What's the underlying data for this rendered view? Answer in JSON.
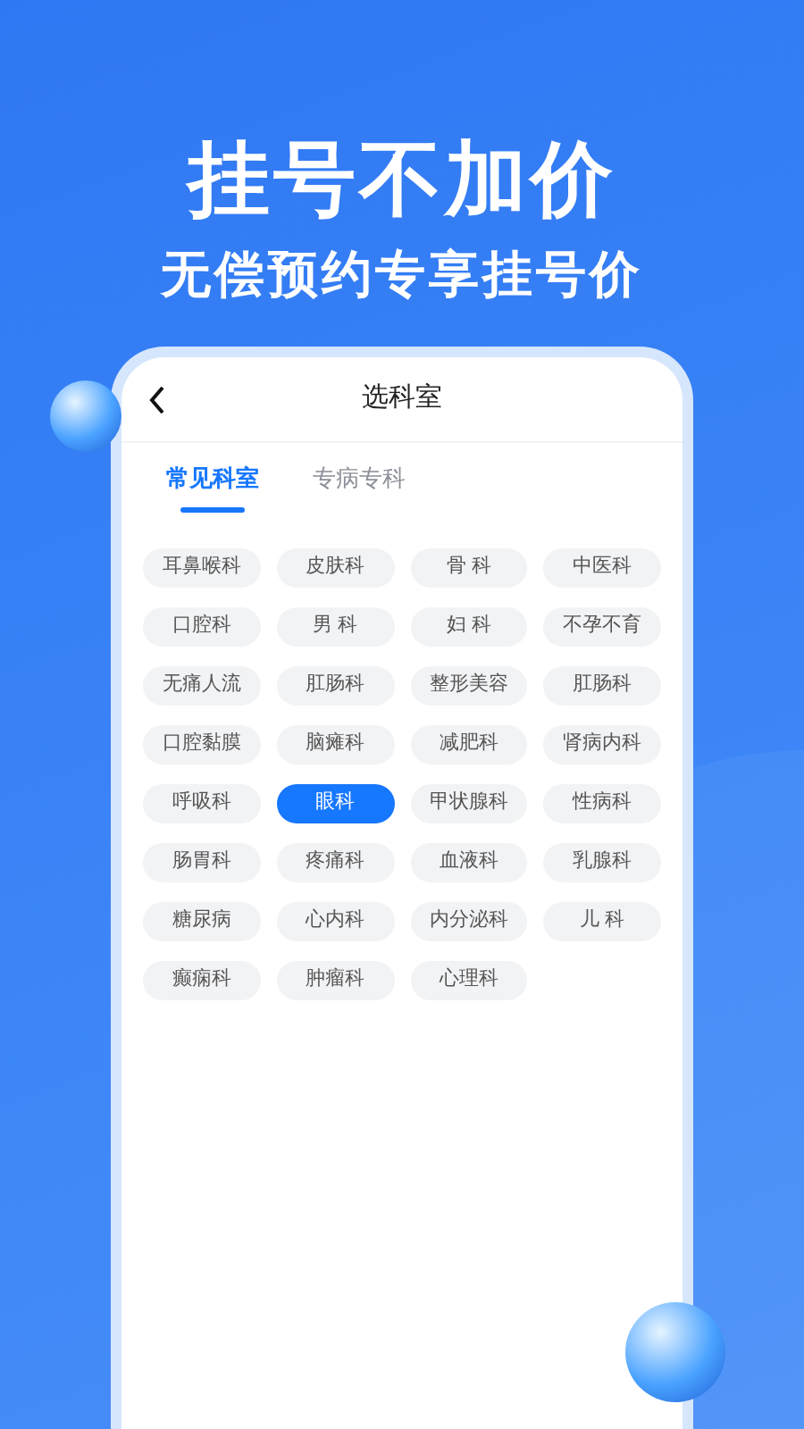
{
  "banner": {
    "headline": "挂号不加价",
    "subtitle": "无偿预约专享挂号价"
  },
  "header": {
    "title": "选科室"
  },
  "tabs": [
    {
      "label": "常见科室",
      "selected": true
    },
    {
      "label": "专病专科",
      "selected": false
    }
  ],
  "departments": [
    {
      "label": "耳鼻喉科",
      "selected": false
    },
    {
      "label": "皮肤科",
      "selected": false
    },
    {
      "label": "骨 科",
      "selected": false
    },
    {
      "label": "中医科",
      "selected": false
    },
    {
      "label": "口腔科",
      "selected": false
    },
    {
      "label": "男 科",
      "selected": false
    },
    {
      "label": "妇 科",
      "selected": false
    },
    {
      "label": "不孕不育",
      "selected": false
    },
    {
      "label": "无痛人流",
      "selected": false
    },
    {
      "label": "肛肠科",
      "selected": false
    },
    {
      "label": "整形美容",
      "selected": false
    },
    {
      "label": "肛肠科",
      "selected": false
    },
    {
      "label": "口腔黏膜",
      "selected": false
    },
    {
      "label": "脑瘫科",
      "selected": false
    },
    {
      "label": "减肥科",
      "selected": false
    },
    {
      "label": "肾病内科",
      "selected": false
    },
    {
      "label": "呼吸科",
      "selected": false
    },
    {
      "label": "眼科",
      "selected": true
    },
    {
      "label": "甲状腺科",
      "selected": false
    },
    {
      "label": "性病科",
      "selected": false
    },
    {
      "label": "肠胃科",
      "selected": false
    },
    {
      "label": "疼痛科",
      "selected": false
    },
    {
      "label": "血液科",
      "selected": false
    },
    {
      "label": "乳腺科",
      "selected": false
    },
    {
      "label": "糖尿病",
      "selected": false
    },
    {
      "label": "心内科",
      "selected": false
    },
    {
      "label": "内分泌科",
      "selected": false
    },
    {
      "label": "儿 科",
      "selected": false
    },
    {
      "label": "癫痫科",
      "selected": false
    },
    {
      "label": "肿瘤科",
      "selected": false
    },
    {
      "label": "心理科",
      "selected": false
    }
  ]
}
